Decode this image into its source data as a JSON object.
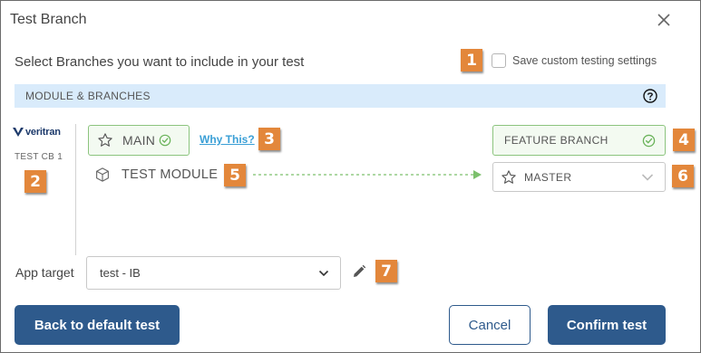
{
  "dialog": {
    "title": "Test Branch",
    "subtitle": "Select Branches you want to include in your test",
    "save_custom_label": "Save custom testing settings",
    "save_custom_checked": false
  },
  "section": {
    "title": "MODULE & BRANCHES"
  },
  "module": {
    "logo_text": "veritran",
    "name": "TEST CB 1"
  },
  "branches": {
    "main_label": "MAIN",
    "why_link": "Why This?",
    "test_module_label": "TEST MODULE",
    "feature_branch_label": "FEATURE BRANCH",
    "master_label": "MASTER"
  },
  "app_target": {
    "label": "App target",
    "value": "test - IB"
  },
  "buttons": {
    "back": "Back to default test",
    "cancel": "Cancel",
    "confirm": "Confirm test"
  },
  "callouts": [
    "1",
    "2",
    "3",
    "4",
    "5",
    "6",
    "7"
  ],
  "colors": {
    "primary": "#2e5a8c",
    "section_bg": "#d9ebfb",
    "success_border": "#8cc47e",
    "callout": "#e3873b",
    "link": "#3a9fd6"
  }
}
